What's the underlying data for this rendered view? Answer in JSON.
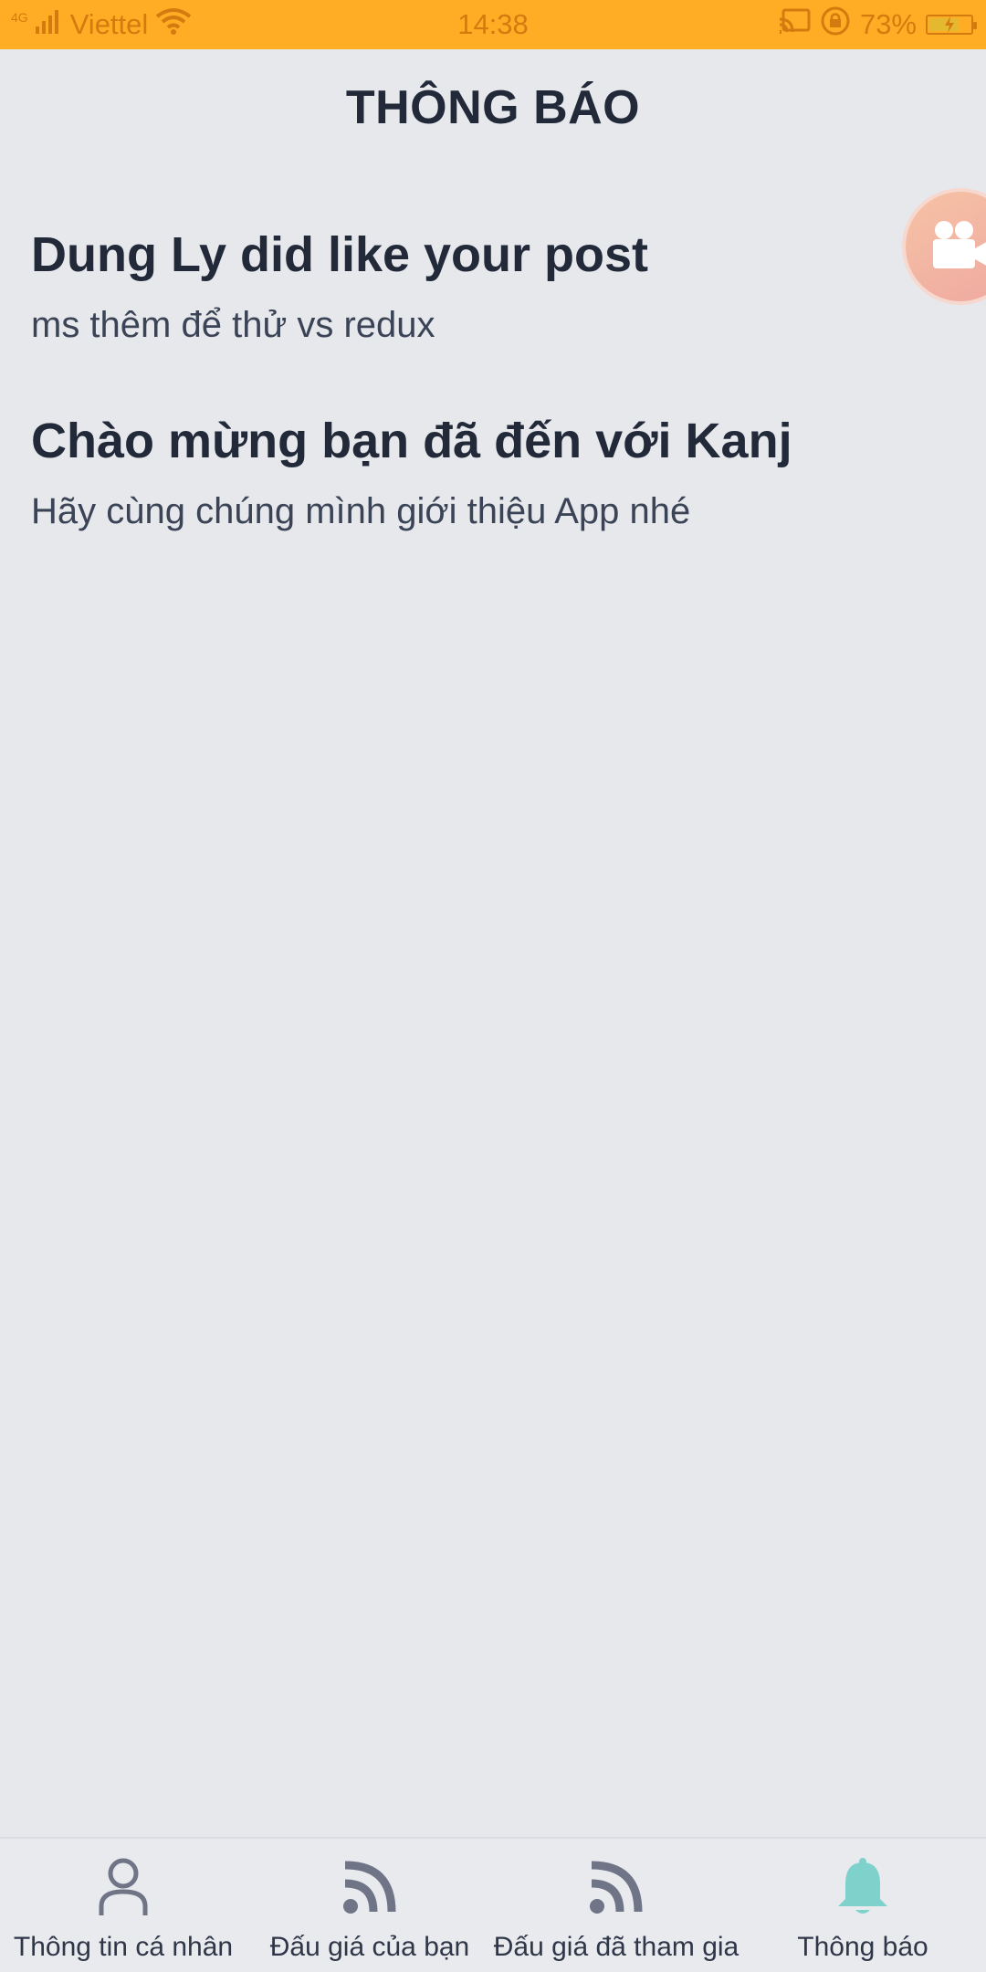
{
  "status_bar": {
    "network": "4G",
    "carrier": "Viettel",
    "time": "14:38",
    "battery": "73%",
    "battery_level": 0.73
  },
  "header": {
    "title": "THÔNG BÁO"
  },
  "notifications": [
    {
      "title": "Dung Ly did like your post",
      "body": "ms thêm để thử vs redux"
    },
    {
      "title": "Chào mừng bạn đã đến với Kanj",
      "body": "Hãy cùng chúng mình giới thiệu App nhé"
    }
  ],
  "bottom_nav": {
    "items": [
      {
        "label": "Thông tin cá nhân",
        "icon": "user-icon"
      },
      {
        "label": "Đấu giá của bạn",
        "icon": "rss-icon"
      },
      {
        "label": "Đấu giá đã tham gia",
        "icon": "rss-icon"
      },
      {
        "label": "Thông báo",
        "icon": "bell-icon",
        "active": true
      }
    ]
  },
  "colors": {
    "status_bar": "#ffad24",
    "background": "#e7e8ec",
    "nav_icon": "#6f7586",
    "nav_active": "#7fd1cc",
    "float_button": "#efa8a0"
  }
}
